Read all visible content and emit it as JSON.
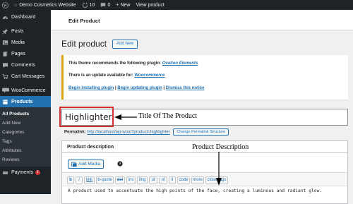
{
  "admin_bar": {
    "site_name": "Demo Cosmetics Website",
    "updates_count": "10",
    "comments_count": "0",
    "new_label": "New",
    "view_product": "View product"
  },
  "sidebar": {
    "items": [
      {
        "label": "Dashboard",
        "icon": "dashboard-icon"
      },
      {
        "label": "Posts",
        "icon": "pin-icon"
      },
      {
        "label": "Media",
        "icon": "media-icon"
      },
      {
        "label": "Pages",
        "icon": "pages-icon"
      },
      {
        "label": "Comments",
        "icon": "comment-icon"
      },
      {
        "label": "Cart Messages",
        "icon": "cart-icon"
      },
      {
        "label": "WooCommerce",
        "icon": "woo-icon"
      },
      {
        "label": "Products",
        "icon": "products-icon"
      }
    ],
    "submenu": [
      "All Products",
      "Add New",
      "Categories",
      "Tags",
      "Attributes",
      "Reviews"
    ],
    "payments": {
      "label": "Payments",
      "badge": "1"
    }
  },
  "header": {
    "breadcrumb": "Edit Product"
  },
  "page": {
    "title": "Edit product",
    "add_new": "Add New"
  },
  "notice": {
    "line1_prefix": "This theme recommends the following plugin:",
    "line1_link": "Ovation Elements",
    "line2_prefix": "There is an update available for:",
    "line2_link": "Woocommerce",
    "link_install": "Begin installing plugin",
    "link_update": "Begin updating plugin",
    "link_dismiss": "Dismiss this notice",
    "sep": "|"
  },
  "product": {
    "title_value": "Highlighter",
    "permalink_label": "Permalink:",
    "permalink_url": "http://localhost/wp-woo/?product=highlighter",
    "change_permalink": "Change Permalink Structure"
  },
  "description": {
    "heading": "Product description",
    "add_media": "Add Media",
    "toolbar": [
      "b",
      "i",
      "link",
      "b-quote",
      "del",
      "ins",
      "img",
      "ul",
      "ol",
      "li",
      "code",
      "more",
      "close tags"
    ],
    "content": "A product used to accentuate the high points of the face, creating a luminous and radiant glow."
  },
  "annotations": {
    "title": "Title Of The Product",
    "description": "Product Description"
  },
  "colors": {
    "admin_dark": "#1d2327",
    "accent": "#2271b1",
    "notice_border": "#dba617",
    "annotation_box": "#d32f2f"
  }
}
